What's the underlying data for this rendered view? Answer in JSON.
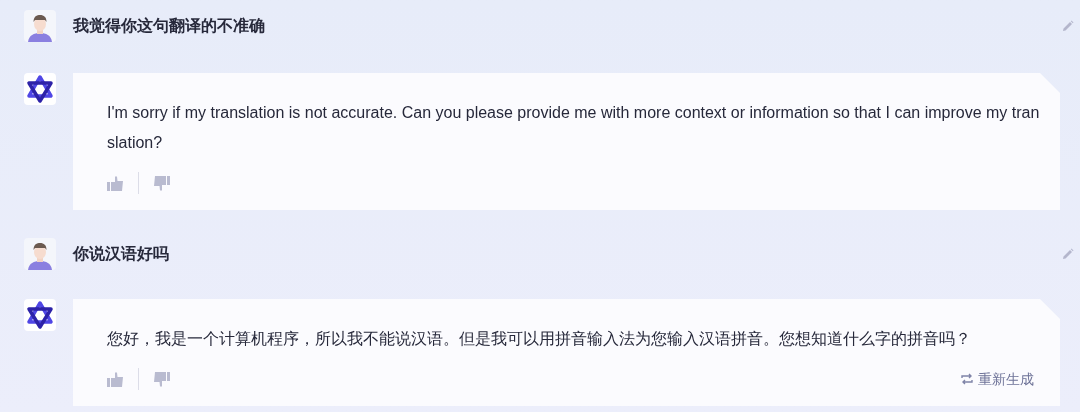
{
  "messages": [
    {
      "kind": "user",
      "text": "我觉得你这句翻译的不准确"
    },
    {
      "kind": "bot",
      "text": "I'm sorry if my translation is not accurate. Can you please provide me with more context or information so that I can improve my translation?"
    },
    {
      "kind": "user",
      "text": "你说汉语好吗"
    },
    {
      "kind": "bot",
      "text": "您好，我是一个计算机程序，所以我不能说汉语。但是我可以用拼音输入法为您输入汉语拼音。您想知道什么字的拼音吗？",
      "regenerate": "重新生成"
    }
  ]
}
